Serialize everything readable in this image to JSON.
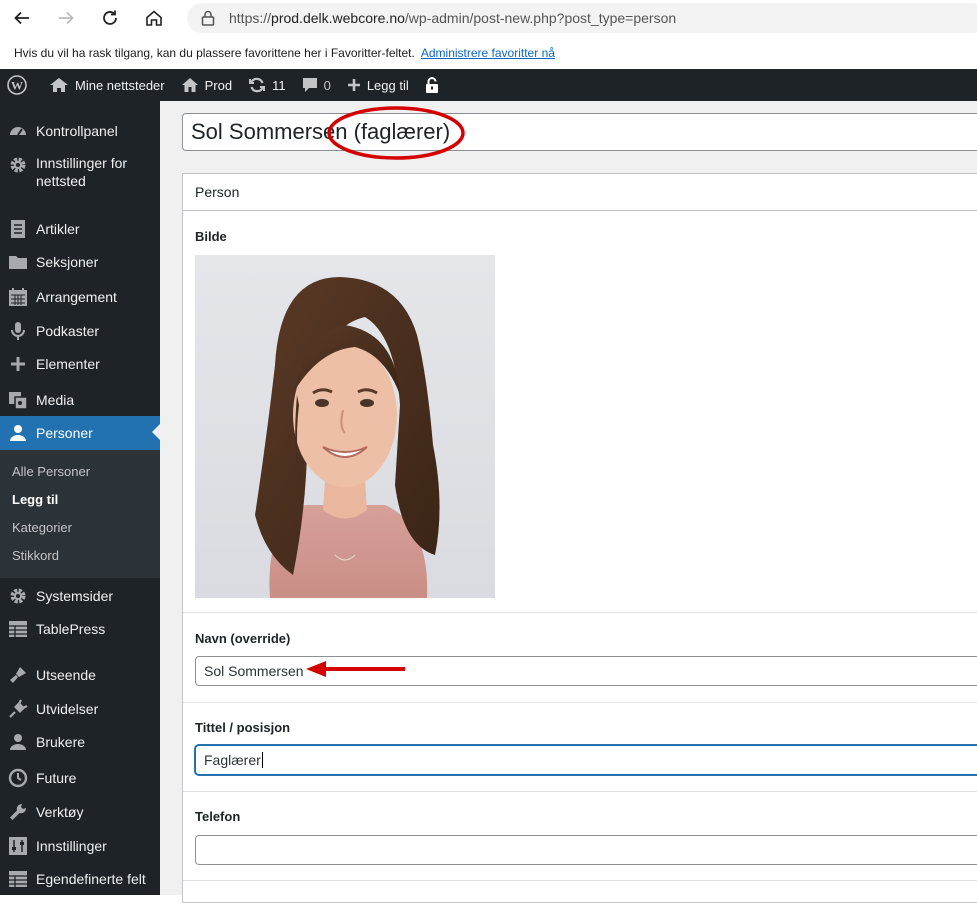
{
  "browser": {
    "url_prefix": "https://",
    "url_host": "prod.delk.webcore.no",
    "url_path": "/wp-admin/post-new.php?post_type=person"
  },
  "favorites_bar": {
    "message": "Hvis du vil ha rask tilgang, kan du plassere favorittene her i Favoritter-feltet.",
    "link": "Administrere favoritter nå"
  },
  "admin_bar": {
    "my_sites": "Mine nettsteder",
    "site": "Prod",
    "updates": "11",
    "comments": "0",
    "new": "Legg til"
  },
  "sidebar": {
    "items": [
      {
        "label": "Kontrollpanel",
        "icon": "dashboard-icon"
      },
      {
        "label": "Innstillinger for nettsted",
        "icon": "gear-icon"
      },
      {
        "label": "Artikler",
        "icon": "document-icon"
      },
      {
        "label": "Seksjoner",
        "icon": "folder-icon"
      },
      {
        "label": "Arrangement",
        "icon": "calendar-icon"
      },
      {
        "label": "Podkaster",
        "icon": "microphone-icon"
      },
      {
        "label": "Elementer",
        "icon": "plus-icon"
      },
      {
        "label": "Media",
        "icon": "media-icon"
      },
      {
        "label": "Personer",
        "icon": "person-icon"
      },
      {
        "label": "Systemsider",
        "icon": "gear-icon"
      },
      {
        "label": "TablePress",
        "icon": "table-icon"
      },
      {
        "label": "Utseende",
        "icon": "brush-icon"
      },
      {
        "label": "Utvidelser",
        "icon": "plug-icon"
      },
      {
        "label": "Brukere",
        "icon": "users-icon"
      },
      {
        "label": "Future",
        "icon": "clock-icon"
      },
      {
        "label": "Verktøy",
        "icon": "wrench-icon"
      },
      {
        "label": "Innstillinger",
        "icon": "settings-sliders-icon"
      },
      {
        "label": "Egendefinerte felt",
        "icon": "table-icon"
      }
    ],
    "submenu": [
      "Alle Personer",
      "Legg til",
      "Kategorier",
      "Stikkord"
    ]
  },
  "editor": {
    "title": "Sol Sommersen (faglærer)",
    "metabox_title": "Person",
    "fields": {
      "image_label": "Bilde",
      "name_label": "Navn (override)",
      "name_value": "Sol Sommersen",
      "position_label": "Tittel / posisjon",
      "position_value": "Faglærer",
      "phone_label": "Telefon",
      "phone_value": ""
    }
  },
  "colors": {
    "admin_dark": "#1d2327",
    "accent": "#2271b1",
    "annotation_red": "#d40000"
  }
}
